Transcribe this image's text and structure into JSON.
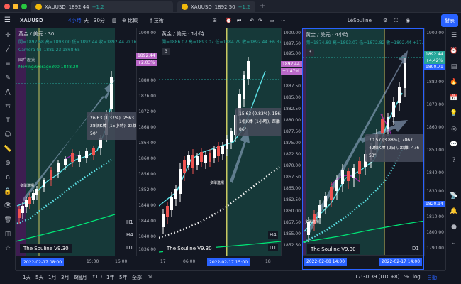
{
  "browser": {
    "tabs": [
      {
        "symbol": "XAUUSD",
        "price": "1892.44",
        "change": "+1.2"
      },
      {
        "symbol": "XAUUSD",
        "price": "1892.50",
        "change": "+1.2"
      }
    ]
  },
  "toolbar": {
    "symbol": "XAUUSD",
    "intervals": [
      "4小時",
      "天",
      "30分"
    ],
    "compare": "比較",
    "indicators": "技術",
    "user": "LéSouline",
    "publish": "發表"
  },
  "panes": [
    {
      "title": "黃金 / 美元 · 30",
      "ohlc": "開=1892.68 高=1893.00 低=1892.44 收=1892.44 -0.16 (-0…",
      "indicator1": "Camera GT  1881.23  1868.65",
      "indicator2": "國戶歷史",
      "indicator3": "MovingAverage300  1848.20",
      "price_ticks": [
        "1900.00",
        "1892.44",
        "1880.00",
        "1876.00",
        "1872.00",
        "1868.00",
        "1864.00",
        "1860.00",
        "1856.00",
        "1852.00",
        "1848.00",
        "1844.00",
        "1840.00",
        "1836.00"
      ],
      "price_tag": "1892.44",
      "price_tag2": "+2.03%",
      "measure": [
        "26.63 (1.37%), 2563",
        "28個K棒 (15小時), 距離: 31",
        "50°"
      ],
      "watermark": "The Souline V9.30",
      "tf": [
        "H1",
        "H4",
        "D1"
      ],
      "time_labels": [
        "15:00",
        "16:00"
      ],
      "time_highlight": "2022-02-17  08:00",
      "label_buy": "多單進場"
    },
    {
      "title": "黃金 / 美元 · 1小時",
      "ohlc": "開=1886.07 高=1893.07 低=1884.79 收=1892.44 +6.37 (+0.3…",
      "pane_num": "3",
      "price_ticks": [
        "1900.00",
        "1897.50",
        "1895.00",
        "1892.44",
        "1890.00",
        "1887.50",
        "1885.00",
        "1882.50",
        "1880.00",
        "1877.50",
        "1875.00",
        "1872.50",
        "1870.00",
        "1867.50",
        "1865.00",
        "1862.50",
        "1860.00",
        "1857.50",
        "1855.00",
        "1852.50"
      ],
      "price_tag": "1892.44",
      "price_tag2": "+1.47%",
      "measure": [
        "15.63 (0.83%), 1563",
        "1根K棒 (1小時), 距離",
        "86°"
      ],
      "watermark": "The Souline V9.30",
      "tf": [
        "H4",
        "D1"
      ],
      "time_labels": [
        "17",
        "06:00",
        "18"
      ],
      "time_highlight": "2022-02-17  15:00",
      "label_buy": "多單進場"
    },
    {
      "title": "黃金 / 美元 · 4小時",
      "ohlc": "開=1874.89 高=1893.07 低=1872.82 收=1892.44 +17.55 (+0.…",
      "pane_num": "3",
      "price_ticks": [
        "1900.00",
        "1892.44",
        "1890.71",
        "1880.00",
        "1870.00",
        "1860.00",
        "1850.00",
        "1840.00",
        "1830.00",
        "1820.14",
        "1810.00",
        "1800.00",
        "1790.00"
      ],
      "price_tag": "1892.44",
      "price_tag2": "+4.42%",
      "price_tag3": "1890.71",
      "price_tag4": "1820.14",
      "measure": [
        "70.57 (3.88%), 7067",
        "42個K棒 (9日), 距離: 476",
        "53°"
      ],
      "watermark": "The Souline V9.30",
      "tf": [
        "D1"
      ],
      "time_highlight": "2022-02-08  14:00",
      "time_highlight2": "2022-02-17  14:00",
      "label_buy": "多單進場"
    }
  ],
  "bottombar": {
    "ranges": [
      "1天",
      "5天",
      "1月",
      "3月",
      "6個月",
      "YTD",
      "1年",
      "5年",
      "全部"
    ],
    "clock": "17:30:39 (UTC+8)",
    "percent": "%",
    "log": "log",
    "auto": "自動"
  },
  "colors": {
    "bg": "#131722",
    "accent": "#2962ff",
    "up": "#26a69a",
    "down": "#ef5350",
    "ma": "#00e676",
    "cyan": "#5ce1e6",
    "purple": "#9c27b0",
    "yellow": "#c8c862"
  }
}
